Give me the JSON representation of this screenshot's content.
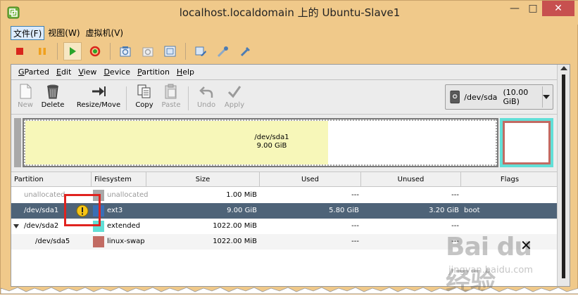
{
  "window": {
    "title": "localhost.localdomain 上的 Ubuntu-Slave1",
    "minimize": "—",
    "maximize": "□",
    "close": "✕"
  },
  "vm_menu": [
    "文件(F)",
    "视图(W)",
    "虚拟机(V)"
  ],
  "vm_toolbar_icons": [
    "stop-icon",
    "pause-icon",
    "play-icon",
    "reset-icon",
    "snapshot-icon",
    "revert-icon",
    "snapshot-manager-icon",
    "settings-icon",
    "tools-icon",
    "wrench-icon"
  ],
  "gparted": {
    "menu": [
      "GParted",
      "Edit",
      "View",
      "Device",
      "Partition",
      "Help"
    ],
    "toolbar": {
      "new": "New",
      "delete": "Delete",
      "resize_move": "Resize/Move",
      "copy": "Copy",
      "paste": "Paste",
      "undo": "Undo",
      "apply": "Apply"
    },
    "device": {
      "name": "/dev/sda",
      "size": "(10.00 GiB)"
    },
    "graph": {
      "label": "/dev/sda1",
      "size": "9.00 GiB",
      "colors": {
        "ext3": "#f7f7b9",
        "swap": "#c26b63",
        "extended": "#62dfd7"
      }
    },
    "columns": {
      "partition": "Partition",
      "filesystem": "Filesystem",
      "size": "Size",
      "used": "Used",
      "unused": "Unused",
      "flags": "Flags"
    },
    "rows": [
      {
        "partition": "unallocated",
        "filesystem": "unallocated",
        "size": "1.00 MiB",
        "used": "---",
        "unused": "---",
        "flags": "",
        "color": "#a9a9a9"
      },
      {
        "partition": "/dev/sda1",
        "filesystem": "ext3",
        "size": "9.00 GiB",
        "used": "5.80 GiB",
        "unused": "3.20 GiB",
        "flags": "boot",
        "color": "#3a6fb5"
      },
      {
        "partition": "/dev/sda2",
        "filesystem": "extended",
        "size": "1022.00 MiB",
        "used": "---",
        "unused": "---",
        "flags": "",
        "color": "#62dfd7"
      },
      {
        "partition": "/dev/sda5",
        "filesystem": "linux-swap",
        "size": "1022.00 MiB",
        "used": "---",
        "unused": "---",
        "flags": "",
        "color": "#c26b63"
      }
    ]
  },
  "overlay": {
    "close_mark": "✕",
    "watermark": "Bai du 经验",
    "watermark_sub": "jingyan.baidu.com"
  }
}
